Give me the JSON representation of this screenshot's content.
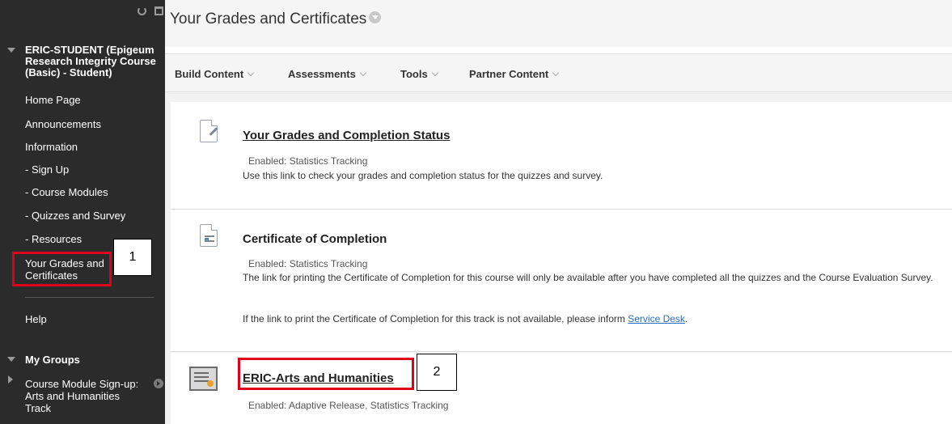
{
  "sidebar": {
    "course_title": "ERIC-STUDENT (Epigeum Research Integrity Course (Basic) - Student)",
    "items": [
      {
        "label": "Home Page"
      },
      {
        "label": "Announcements"
      },
      {
        "label": "Information"
      },
      {
        "label": "- Sign Up"
      },
      {
        "label": "- Course Modules"
      },
      {
        "label": "- Quizzes and Survey"
      },
      {
        "label": "- Resources"
      },
      {
        "label": "Your Grades and Certificates"
      },
      {
        "label": "Help"
      }
    ],
    "groups_heading": "My Groups",
    "group_item": "Course Module Sign-up: Arts and Humanities Track"
  },
  "header": {
    "title": "Your Grades and Certificates"
  },
  "action_bar": {
    "items": [
      {
        "label": "Build Content"
      },
      {
        "label": "Assessments"
      },
      {
        "label": "Tools"
      },
      {
        "label": "Partner Content"
      }
    ]
  },
  "content": {
    "items": [
      {
        "title": "Your Grades and Completion Status",
        "meta": "Enabled:  Statistics Tracking",
        "desc": "Use this link to check your grades and completion status for the quizzes and survey.",
        "icon": "assignment-icon"
      },
      {
        "title": "Certificate of Completion",
        "meta": "Enabled:  Statistics Tracking",
        "desc": "The link for printing the Certificate of Completion for this course will only be available after you have completed all the quizzes and the Course Evaluation Survey.",
        "desc2_prefix": "If the link to print the Certificate of Completion for this track is not available, please inform ",
        "desc2_link": "Service Desk",
        "desc2_suffix": ".",
        "icon": "file-icon"
      },
      {
        "title": "ERIC-Arts and Humanities",
        "meta": "Enabled:  Adaptive Release, Statistics Tracking",
        "icon": "certificate-icon"
      }
    ]
  },
  "annotations": {
    "callout_1": "1",
    "callout_2": "2",
    "highlight_color": "#e0001b"
  }
}
